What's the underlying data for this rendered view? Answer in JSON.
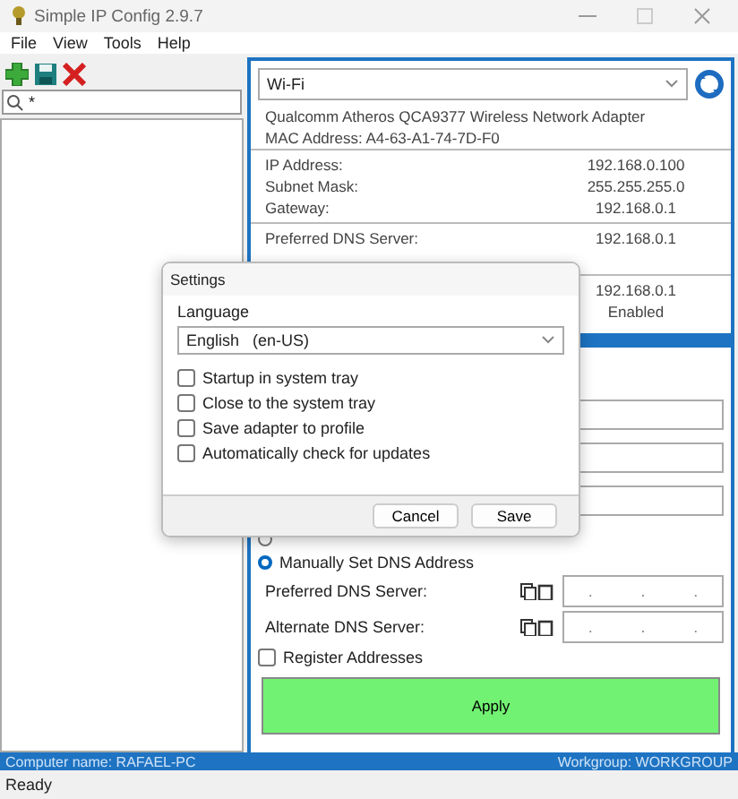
{
  "window": {
    "title": "Simple IP Config 2.9.7"
  },
  "menu": [
    "File",
    "View",
    "Tools",
    "Help"
  ],
  "search": {
    "value": "*"
  },
  "adapter": {
    "selected_adapter": "Wi-Fi",
    "description": "Qualcomm Atheros QCA9377 Wireless Network Adapter",
    "mac": "MAC Address: A4-63-A1-74-7D-F0"
  },
  "info_rows": [
    {
      "label": "IP Address:",
      "value": "192.168.0.100"
    },
    {
      "label": "Subnet Mask:",
      "value": "255.255.255.0"
    },
    {
      "label": "Gateway:",
      "value": "192.168.0.1"
    }
  ],
  "dns_rows": [
    {
      "label": "Preferred DNS Server:",
      "value": "192.168.0.1"
    }
  ],
  "partly_hidden_values": [
    "192.168.0.1",
    "Enabled"
  ],
  "dns_mode": [
    {
      "selected": false
    },
    {
      "label": "Manually Set DNS Address",
      "selected": true
    }
  ],
  "dns_fields": [
    {
      "label": "Preferred DNS Server:",
      "separators": [
        ".",
        ".",
        "."
      ]
    },
    {
      "label": "Alternate DNS Server:",
      "separators": [
        ".",
        ".",
        "."
      ]
    }
  ],
  "register": {
    "label": "Register Addresses",
    "checked": false
  },
  "apply": "Apply",
  "footer": {
    "computer": "Computer name: RAFAEL-PC",
    "workgroup": "Workgroup: WORKGROUP"
  },
  "status": "Ready",
  "dialog": {
    "title": "Settings",
    "language_label": "Language",
    "language": "English   (en-US)",
    "options": [
      {
        "label": "Startup in system tray",
        "checked": false
      },
      {
        "label": "Close to the system tray",
        "checked": false
      },
      {
        "label": "Save adapter to profile",
        "checked": false
      },
      {
        "label": "Automatically check for updates",
        "checked": false
      }
    ],
    "buttons": [
      "Cancel",
      "Save"
    ]
  }
}
